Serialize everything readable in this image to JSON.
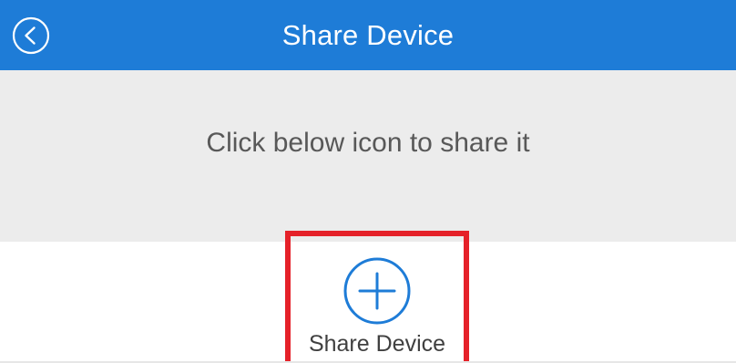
{
  "header": {
    "title": "Share Device",
    "back_icon": "chevron-left-circle-icon"
  },
  "hint": {
    "text": "Click below icon to share it"
  },
  "share": {
    "label": "Share Device",
    "icon": "plus-circle-icon"
  },
  "colors": {
    "app_bar": "#1e7cd7",
    "hint_background": "#ececec",
    "highlight_border": "#e52129",
    "icon_blue": "#1e7cd7"
  }
}
